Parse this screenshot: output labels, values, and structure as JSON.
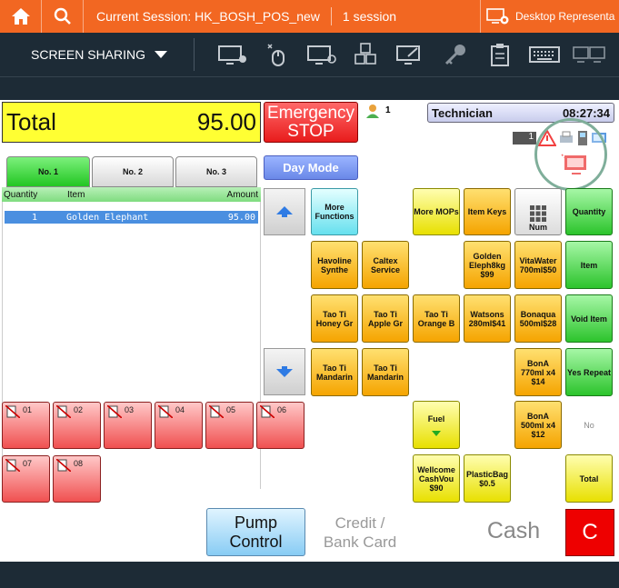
{
  "topbar": {
    "session_title": "Current Session: HK_BOSH_POS_new",
    "session_count": "1 session",
    "desktop_label": "Desktop Representa"
  },
  "toolbar": {
    "screen_sharing": "SCREEN SHARING",
    "tools": [
      "monitor-settings-icon",
      "mouse-icon",
      "power-monitor-icon",
      "keyboard-keys-icon",
      "magic-monitor-icon",
      "key-icon",
      "clipboard-icon",
      "keyboard-icon",
      "dual-monitor-icon",
      "single-monitor-icon"
    ]
  },
  "pos": {
    "total_label": "Total",
    "total_amount": "95.00",
    "emergency_line1": "Emergency",
    "emergency_line2": "STOP",
    "user_count": "1",
    "technician_label": "Technician",
    "clock": "08:27:34",
    "tray_badge": "1",
    "tabs": [
      "No. 1",
      "No. 2",
      "No. 3"
    ],
    "day_mode": "Day Mode",
    "list_headers": {
      "quantity": "Quantity",
      "item": "Item",
      "amount": "Amount"
    },
    "list_rows": [
      {
        "qty": "1",
        "item": "Golden Elephant",
        "amount": "95.00"
      }
    ],
    "keys": {
      "more_functions": "More Functions",
      "more_mops": "More MOPs",
      "item_keys": "Item Keys",
      "num": "Num",
      "quantity": "Quantity",
      "havoline": "Havoline Synthe",
      "caltex": "Caltex Service",
      "golden_eleph": "Golden Eleph8kg $99",
      "vitawater": "VitaWater 700ml$50",
      "item": "Item",
      "taoti_honey": "Tao Ti Honey Gr",
      "taoti_apple": "Tao Ti Apple Gr",
      "taoti_orange": "Tao Ti Orange B",
      "watsons": "Watsons 280ml$41",
      "bonaqua": "Bonaqua 500ml$28",
      "void_item": "Void Item",
      "taoti_mandarin1": "Tao Ti Mandarin",
      "taoti_mandarin2": "Tao Ti Mandarin",
      "bona_770": "BonA 770ml x4 $14",
      "yes_repeat": "Yes Repeat",
      "fuel": "Fuel",
      "bona_500": "BonA 500ml x4 $12",
      "no": "No",
      "wellcome": "Wellcome CashVou $90",
      "plasticbag": "PlasticBag $0.5",
      "total": "Total"
    },
    "pumps": [
      "01",
      "02",
      "03",
      "04",
      "05",
      "06",
      "07",
      "08"
    ],
    "pump_control_line1": "Pump",
    "pump_control_line2": "Control",
    "credit_line1": "Credit /",
    "credit_line2": "Bank Card",
    "cash": "Cash",
    "clear": "C"
  },
  "colors": {
    "accent": "#f26722",
    "toolbar_bg": "#1d2b36"
  }
}
